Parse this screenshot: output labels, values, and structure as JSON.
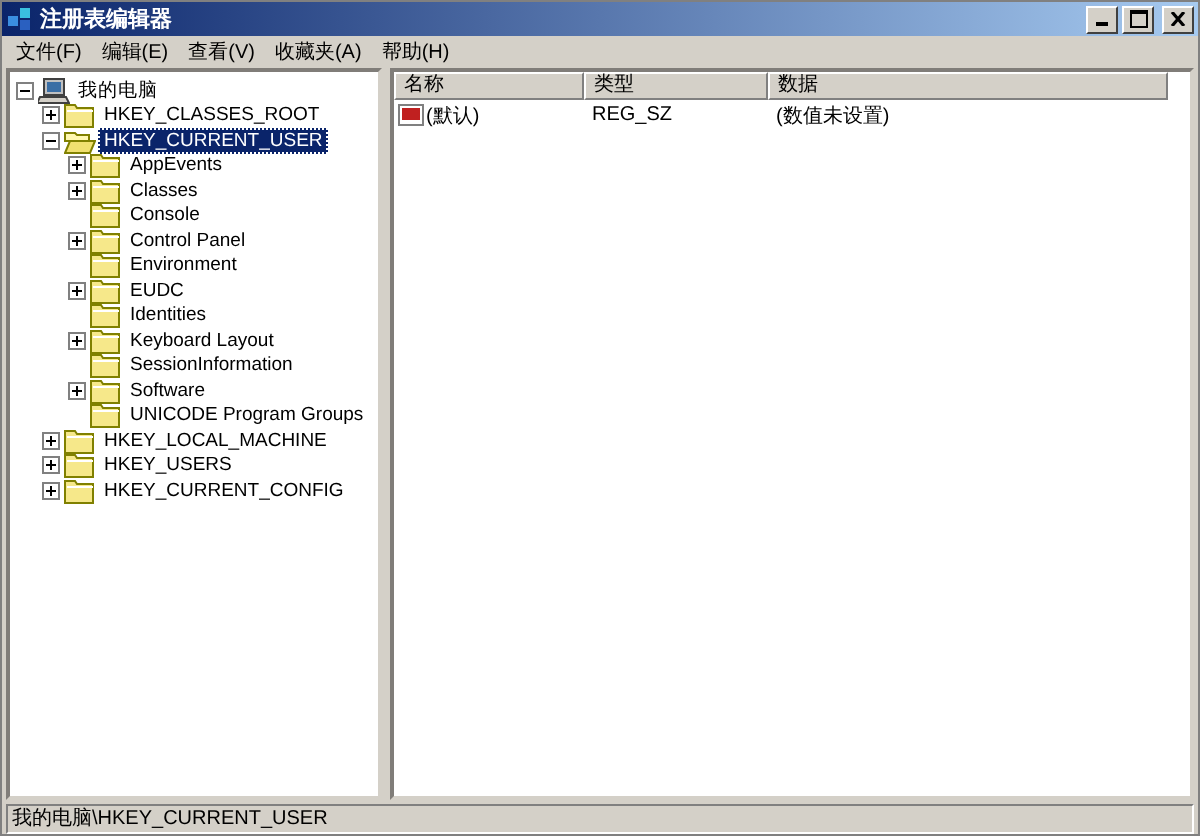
{
  "window": {
    "title": "注册表编辑器"
  },
  "menu": [
    "文件(F)",
    "编辑(E)",
    "查看(V)",
    "收藏夹(A)",
    "帮助(H)"
  ],
  "tree": [
    {
      "label": "我的电脑",
      "kind": "computer",
      "expandable": true,
      "expanded": true,
      "selected": false,
      "children": [
        {
          "label": "HKEY_CLASSES_ROOT",
          "kind": "folder",
          "expandable": true,
          "expanded": false,
          "selected": false
        },
        {
          "label": "HKEY_CURRENT_USER",
          "kind": "folder",
          "expandable": true,
          "expanded": true,
          "selected": true,
          "children": [
            {
              "label": "AppEvents",
              "kind": "folder",
              "expandable": true,
              "expanded": false,
              "selected": false
            },
            {
              "label": "Classes",
              "kind": "folder",
              "expandable": true,
              "expanded": false,
              "selected": false
            },
            {
              "label": "Console",
              "kind": "folder",
              "expandable": false,
              "expanded": false,
              "selected": false
            },
            {
              "label": "Control Panel",
              "kind": "folder",
              "expandable": true,
              "expanded": false,
              "selected": false
            },
            {
              "label": "Environment",
              "kind": "folder",
              "expandable": false,
              "expanded": false,
              "selected": false
            },
            {
              "label": "EUDC",
              "kind": "folder",
              "expandable": true,
              "expanded": false,
              "selected": false
            },
            {
              "label": "Identities",
              "kind": "folder",
              "expandable": false,
              "expanded": false,
              "selected": false
            },
            {
              "label": "Keyboard Layout",
              "kind": "folder",
              "expandable": true,
              "expanded": false,
              "selected": false
            },
            {
              "label": "SessionInformation",
              "kind": "folder",
              "expandable": false,
              "expanded": false,
              "selected": false
            },
            {
              "label": "Software",
              "kind": "folder",
              "expandable": true,
              "expanded": false,
              "selected": false
            },
            {
              "label": "UNICODE Program Groups",
              "kind": "folder",
              "expandable": false,
              "expanded": false,
              "selected": false
            }
          ]
        },
        {
          "label": "HKEY_LOCAL_MACHINE",
          "kind": "folder",
          "expandable": true,
          "expanded": false,
          "selected": false
        },
        {
          "label": "HKEY_USERS",
          "kind": "folder",
          "expandable": true,
          "expanded": false,
          "selected": false
        },
        {
          "label": "HKEY_CURRENT_CONFIG",
          "kind": "folder",
          "expandable": true,
          "expanded": false,
          "selected": false
        }
      ]
    }
  ],
  "table": {
    "columns": [
      "名称",
      "类型",
      "数据"
    ],
    "rows": [
      {
        "name": "(默认)",
        "type": "REG_SZ",
        "data": "(数值未设置)"
      }
    ]
  },
  "status_bar": "我的电脑\\HKEY_CURRENT_USER"
}
